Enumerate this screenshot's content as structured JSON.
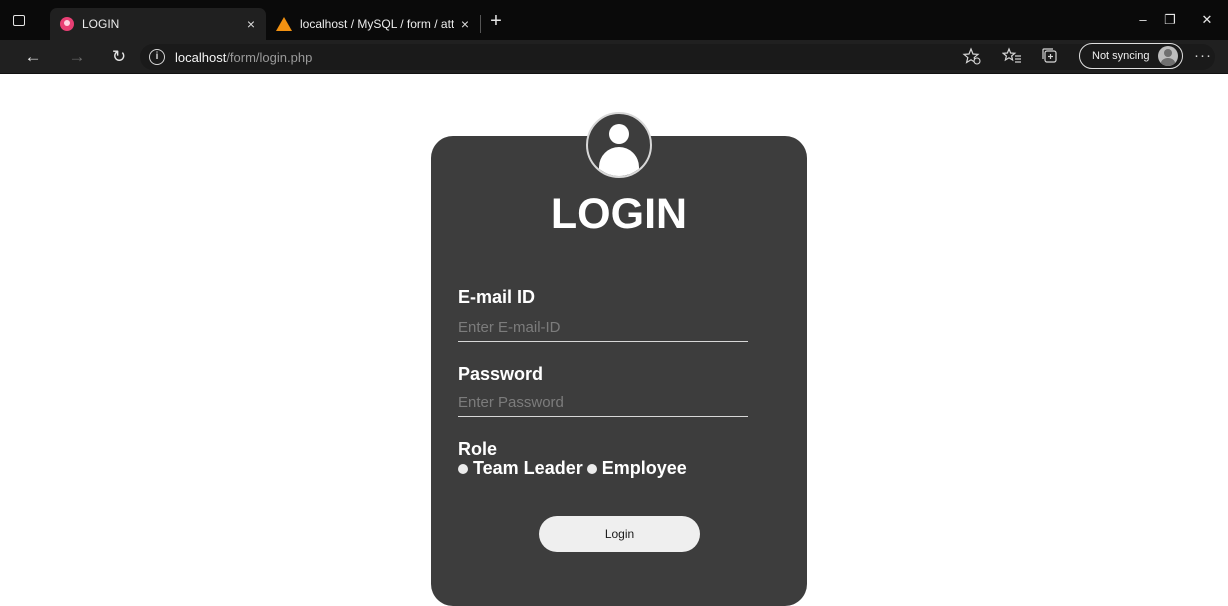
{
  "browser": {
    "tabs": [
      {
        "title": "LOGIN",
        "active": true
      },
      {
        "title": "localhost / MySQL / form / atten",
        "active": false
      }
    ],
    "tab_close_glyph": "×",
    "new_tab_glyph": "+",
    "window_controls": {
      "minimize": "–",
      "restore": "❐",
      "close": "✕"
    },
    "nav": {
      "back": "←",
      "forward": "→",
      "refresh": "↻"
    },
    "address": {
      "info_glyph": "i",
      "host": "localhost",
      "path": "/form/login.php"
    },
    "sync_label": "Not syncing",
    "menu_glyph": "···"
  },
  "login": {
    "title": "LOGIN",
    "email_label": "E-mail ID",
    "email_placeholder": "Enter E-mail-ID",
    "password_label": "Password",
    "password_placeholder": "Enter Password",
    "role_label": "Role",
    "roles": [
      "Team Leader",
      "Employee"
    ],
    "submit_label": "Login"
  },
  "colors": {
    "card_bg": "#3d3d3d",
    "tab_favicon": "#e83f74",
    "pma_favicon": "#f29111"
  }
}
